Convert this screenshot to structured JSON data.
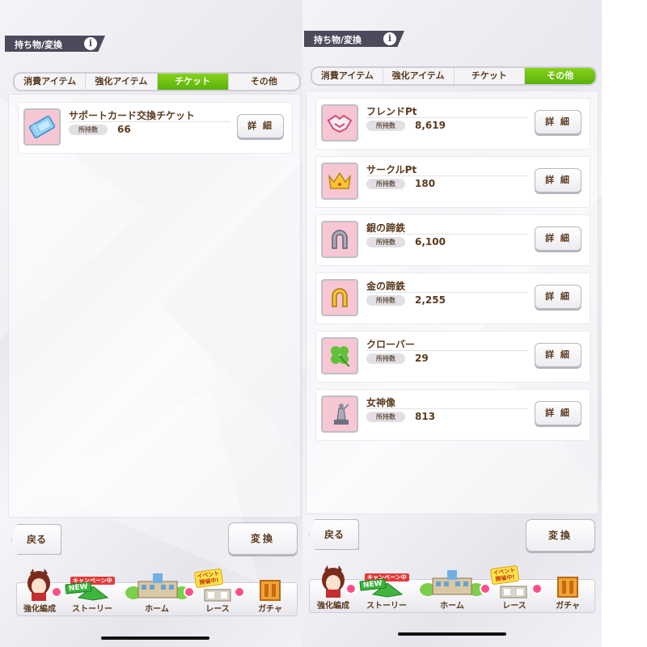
{
  "left": {
    "header": {
      "title": "持ち物/変換",
      "info_icon": "info-icon"
    },
    "tabs": [
      {
        "label": "消費アイテム",
        "active": false
      },
      {
        "label": "強化アイテム",
        "active": false
      },
      {
        "label": "チケット",
        "active": true
      },
      {
        "label": "その他",
        "active": false
      }
    ],
    "items": [
      {
        "name": "サポートカード交換チケット",
        "owned_label": "所持数",
        "count": "66",
        "detail_label": "詳 細",
        "icon": "ticket-icon"
      }
    ],
    "back_label": "戻る",
    "convert_label": "変換"
  },
  "right": {
    "header": {
      "title": "持ち物/変換",
      "info_icon": "info-icon"
    },
    "tabs": [
      {
        "label": "消費アイテム",
        "active": false
      },
      {
        "label": "強化アイテム",
        "active": false
      },
      {
        "label": "チケット",
        "active": false
      },
      {
        "label": "その他",
        "active": true
      }
    ],
    "items": [
      {
        "name": "フレンドPt",
        "owned_label": "所持数",
        "count": "8,619",
        "detail_label": "詳 細",
        "icon": "handshake-icon"
      },
      {
        "name": "サークルPt",
        "owned_label": "所持数",
        "count": "180",
        "detail_label": "詳 細",
        "icon": "crown-icon"
      },
      {
        "name": "銀の蹄鉄",
        "owned_label": "所持数",
        "count": "6,100",
        "detail_label": "詳 細",
        "icon": "silver-horseshoe-icon"
      },
      {
        "name": "金の蹄鉄",
        "owned_label": "所持数",
        "count": "2,255",
        "detail_label": "詳 細",
        "icon": "gold-horseshoe-icon"
      },
      {
        "name": "クローバー",
        "owned_label": "所持数",
        "count": "29",
        "detail_label": "詳 細",
        "icon": "clover-icon"
      },
      {
        "name": "女神像",
        "owned_label": "所持数",
        "count": "813",
        "detail_label": "詳 細",
        "icon": "goddess-statue-icon"
      }
    ],
    "back_label": "戻る",
    "convert_label": "変換"
  },
  "nav": {
    "items": [
      {
        "label": "強化編成"
      },
      {
        "label": "ストーリー"
      },
      {
        "label": "ホーム"
      },
      {
        "label": "レース"
      },
      {
        "label": "ガチャ"
      }
    ],
    "campaign_badge": "キャンペーン中",
    "new_badge": "NEW",
    "event_badge_line1": "イベント",
    "event_badge_line2": "開催中!"
  },
  "colors": {
    "accent_green": "#6cc11a",
    "text_brown": "#5b3a1e",
    "header_dark": "#4b4b5c",
    "icon_pink": "#f7c6d3"
  }
}
